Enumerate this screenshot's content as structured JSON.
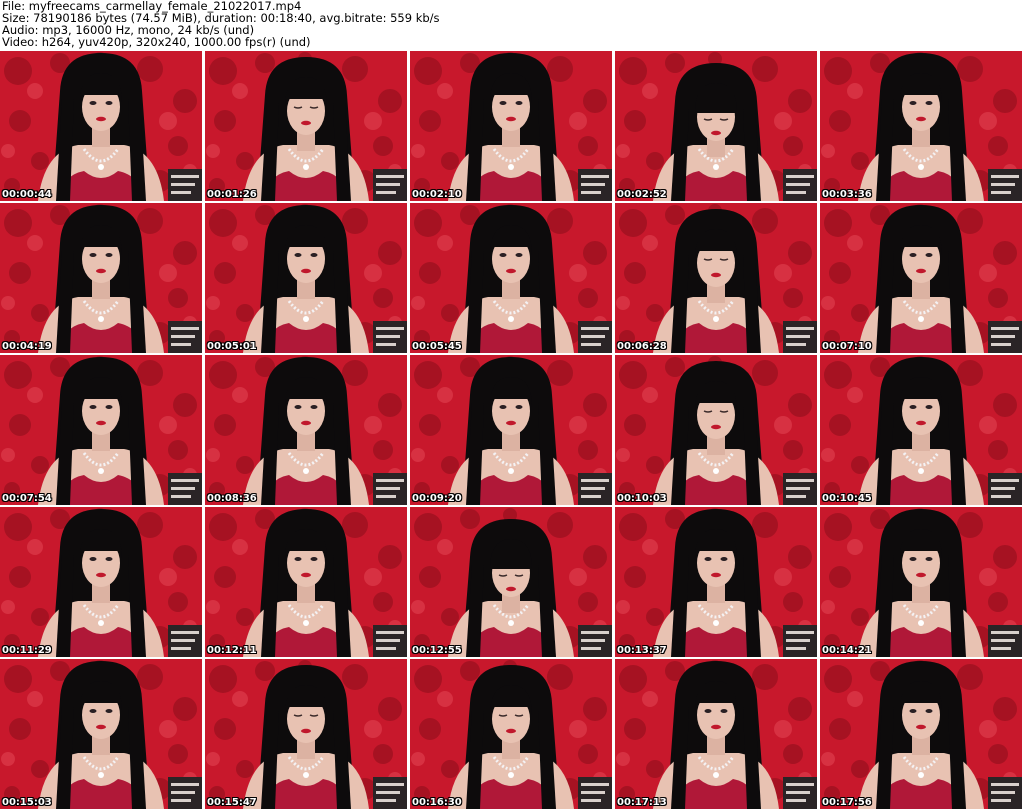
{
  "header": {
    "file_line": "File: myfreecams_carmellay_female_21022017.mp4",
    "size_line": "Size: 78190186 bytes (74.57 MiB), duration: 00:18:40, avg.bitrate: 559 kb/s",
    "audio_line": "Audio: mp3, 16000 Hz, mono, 24 kb/s (und)",
    "video_line": "Video: h264, yuv420p, 320x240, 1000.00 fps(r) (und)"
  },
  "colors": {
    "background_red": "#c8182c",
    "dark_red": "#8a0e1c",
    "hair": "#0d0b0c",
    "skin": "#e8c2b2",
    "top": "#b01838",
    "timestamp_text": "#ffffff"
  },
  "thumbnails": [
    {
      "timestamp": "00:00:44",
      "pose": "front"
    },
    {
      "timestamp": "00:01:26",
      "pose": "down"
    },
    {
      "timestamp": "00:02:10",
      "pose": "front"
    },
    {
      "timestamp": "00:02:52",
      "pose": "head-down"
    },
    {
      "timestamp": "00:03:36",
      "pose": "front"
    },
    {
      "timestamp": "00:04:19",
      "pose": "front"
    },
    {
      "timestamp": "00:05:01",
      "pose": "front"
    },
    {
      "timestamp": "00:05:45",
      "pose": "front"
    },
    {
      "timestamp": "00:06:28",
      "pose": "down"
    },
    {
      "timestamp": "00:07:10",
      "pose": "front"
    },
    {
      "timestamp": "00:07:54",
      "pose": "front"
    },
    {
      "timestamp": "00:08:36",
      "pose": "front"
    },
    {
      "timestamp": "00:09:20",
      "pose": "front"
    },
    {
      "timestamp": "00:10:03",
      "pose": "down"
    },
    {
      "timestamp": "00:10:45",
      "pose": "front"
    },
    {
      "timestamp": "00:11:29",
      "pose": "front"
    },
    {
      "timestamp": "00:12:11",
      "pose": "front"
    },
    {
      "timestamp": "00:12:55",
      "pose": "head-down"
    },
    {
      "timestamp": "00:13:37",
      "pose": "front"
    },
    {
      "timestamp": "00:14:21",
      "pose": "front"
    },
    {
      "timestamp": "00:15:03",
      "pose": "front"
    },
    {
      "timestamp": "00:15:47",
      "pose": "down"
    },
    {
      "timestamp": "00:16:30",
      "pose": "down"
    },
    {
      "timestamp": "00:17:13",
      "pose": "front"
    },
    {
      "timestamp": "00:17:56",
      "pose": "front"
    }
  ]
}
